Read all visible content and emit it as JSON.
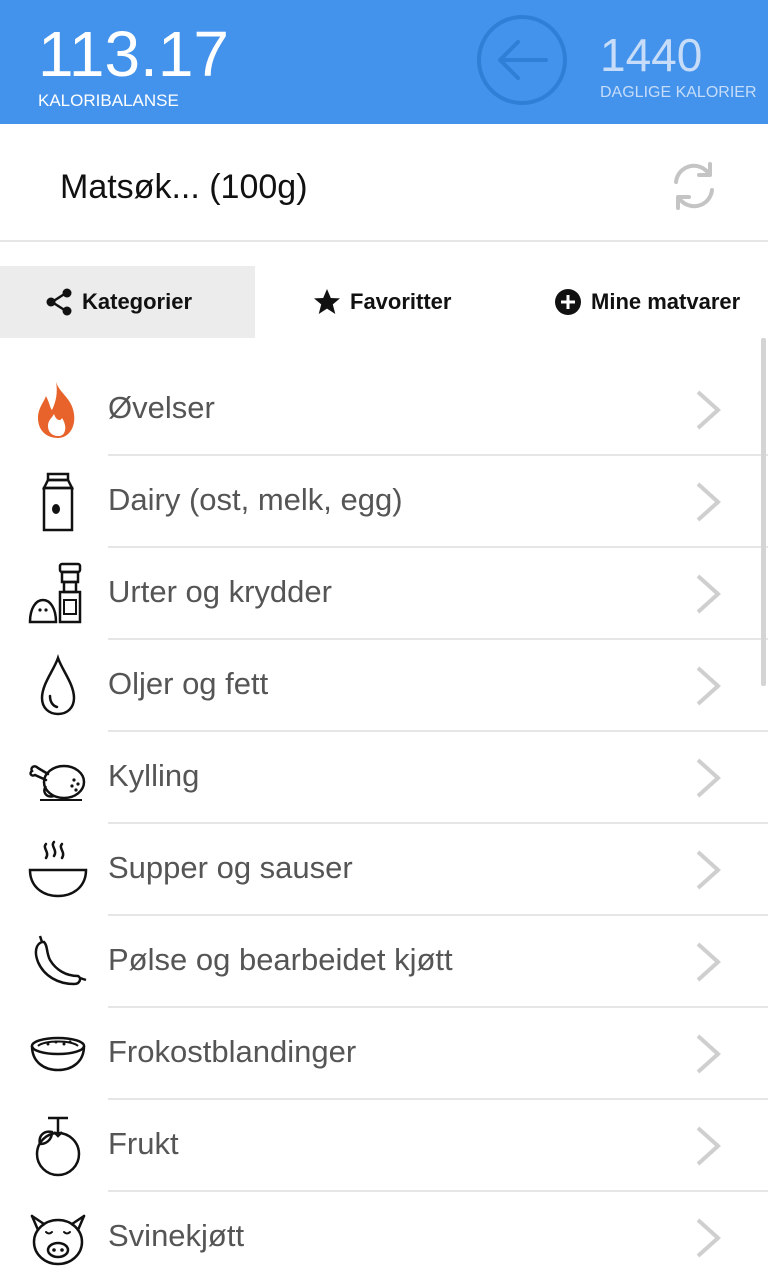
{
  "header": {
    "balance_value": "113.17",
    "balance_label": "KALORIBALANSE",
    "daily_value": "1440",
    "daily_label": "DAGLIGE KALORIER",
    "back_icon": "arrow-left-circle-icon"
  },
  "search": {
    "text": "Matsøk... (100g)",
    "refresh_icon": "refresh-icon"
  },
  "tabs": [
    {
      "label": "Kategorier",
      "icon": "share-icon",
      "selected": true
    },
    {
      "label": "Favoritter",
      "icon": "star-icon",
      "selected": false
    },
    {
      "label": "Mine matvarer",
      "icon": "plus-circle-icon",
      "selected": false
    }
  ],
  "categories": [
    {
      "label": "Øvelser",
      "icon": "flame-icon"
    },
    {
      "label": "Dairy (ost, melk, egg)",
      "icon": "milk-carton-icon"
    },
    {
      "label": "Urter og krydder",
      "icon": "salt-pepper-icon"
    },
    {
      "label": "Oljer og fett",
      "icon": "oil-drop-icon"
    },
    {
      "label": "Kylling",
      "icon": "chicken-icon"
    },
    {
      "label": "Supper og sauser",
      "icon": "soup-bowl-icon"
    },
    {
      "label": "Pølse og bearbeidet kjøtt",
      "icon": "sausage-icon"
    },
    {
      "label": "Frokostblandinger",
      "icon": "cereal-bowl-icon"
    },
    {
      "label": "Frukt",
      "icon": "fruit-icon"
    },
    {
      "label": "Svinekjøtt",
      "icon": "pig-icon"
    }
  ],
  "colors": {
    "header_bg": "#4393ec",
    "selected_tab_bg": "#ececec",
    "flame": "#e8632b"
  }
}
